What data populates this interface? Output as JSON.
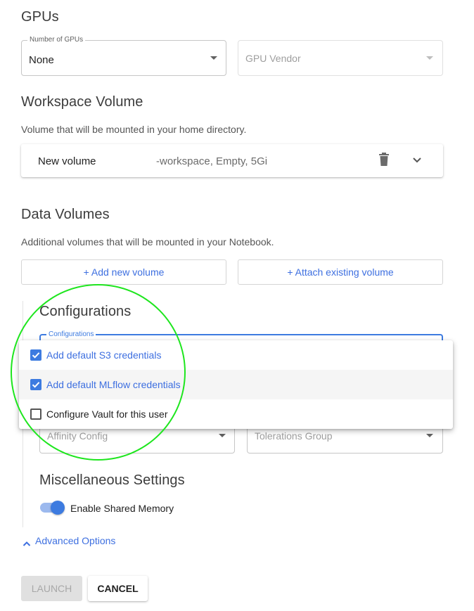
{
  "gpus": {
    "title": "GPUs",
    "number_label": "Number of GPUs",
    "number_value": "None",
    "vendor_placeholder": "GPU Vendor"
  },
  "workspace": {
    "title": "Workspace Volume",
    "description": "Volume that will be mounted in your home directory.",
    "volume_name": "New volume",
    "volume_details": "-workspace, Empty, 5Gi"
  },
  "data_volumes": {
    "title": "Data Volumes",
    "description": "Additional volumes that will be mounted in your Notebook.",
    "add_new_label": "+ Add new volume",
    "attach_existing_label": "+ Attach existing volume"
  },
  "configurations": {
    "title": "Configurations",
    "field_label": "Configurations",
    "options": [
      {
        "label": "Add default S3 credentials",
        "checked": true
      },
      {
        "label": "Add default MLflow credentials",
        "checked": true
      },
      {
        "label": "Configure Vault for this user",
        "checked": false
      }
    ],
    "affinity_placeholder": "Affinity Config",
    "tolerations_placeholder": "Tolerations Group"
  },
  "misc": {
    "title": "Miscellaneous Settings",
    "shared_memory_label": "Enable Shared Memory",
    "shared_memory_enabled": true
  },
  "advanced": {
    "label": "Advanced Options",
    "icon": "chevron-up-icon"
  },
  "actions": {
    "launch_label": "LAUNCH",
    "cancel_label": "CANCEL"
  },
  "colors": {
    "accent": "#3d7be0",
    "link": "#3d6fe0",
    "highlight_circle": "#1ee61e"
  }
}
